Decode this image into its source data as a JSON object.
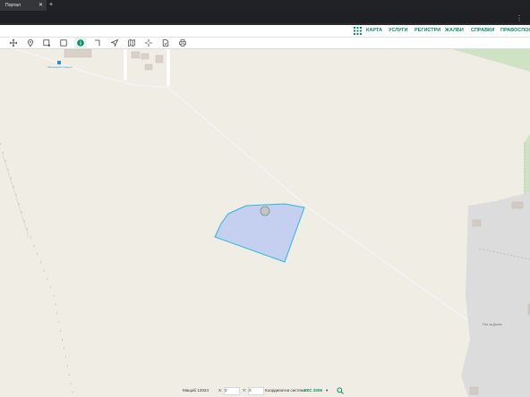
{
  "browser": {
    "tab_title": "Портал",
    "tab_close": "✕",
    "new_tab": "+"
  },
  "nav": {
    "grid_icon": "apps-grid-icon",
    "items": [
      "КАРТА",
      "УСЛУГИ",
      "РЕГИСТРИ",
      "ЖАЛБИ",
      "СПРАВКИ",
      "ПРАВОСПОСО"
    ]
  },
  "toolbar": {
    "tools": [
      "move-icon",
      "pin-icon",
      "select-rect-icon",
      "fullscreen-icon",
      "info-icon",
      "measure-angle-icon",
      "navigate-icon",
      "map-layers-icon",
      "crosshair-icon",
      "document-icon",
      "print-icon"
    ],
    "active_tool": "info-icon"
  },
  "map": {
    "poi_label": "Бензинова станция",
    "street_label": "Път за Долно",
    "accent_color": "#0e8a6a",
    "parcel_fill": "#c5d0f0",
    "parcel_stroke": "#29b6e0"
  },
  "status": {
    "scale_label": "Мащаб 1:",
    "scale_value": "2024",
    "x_label": "X:",
    "x_value": "0",
    "y_label": "Y:",
    "y_value": "0",
    "crs_label": "Координатна система:",
    "crs_value": "ККС 2005",
    "crs_dropdown": "▾"
  }
}
